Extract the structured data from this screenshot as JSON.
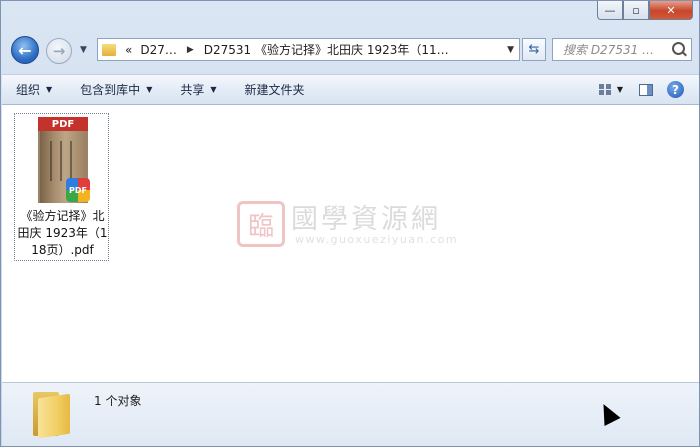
{
  "window": {
    "buttons": {
      "minimize": "—",
      "maximize": "▫",
      "close": "✕"
    }
  },
  "nav": {
    "back": "←",
    "forward": "→",
    "address": {
      "overflow": "«",
      "crumb1": "D27…",
      "crumb2": "D27531 《验方记择》北田庆 1923年（11…"
    },
    "search_placeholder": "搜索 D27531 …"
  },
  "toolbar": {
    "organize": "组织",
    "include_in_library": "包含到库中",
    "share": "共享",
    "new_folder": "新建文件夹",
    "help": "?"
  },
  "files": [
    {
      "name": "《验方记择》北田庆 1923年（118页）.pdf",
      "thumb_label": "PDF",
      "badge": "PDF",
      "selected": true
    }
  ],
  "watermark": {
    "title": "國學資源網",
    "url": "www.guoxueziyuan.com",
    "seal": "臨"
  },
  "details": {
    "count": "1 个对象"
  },
  "colors": {
    "accent": "#2f6fc4",
    "close": "#c7462b",
    "pdf_red": "#c3332b"
  }
}
